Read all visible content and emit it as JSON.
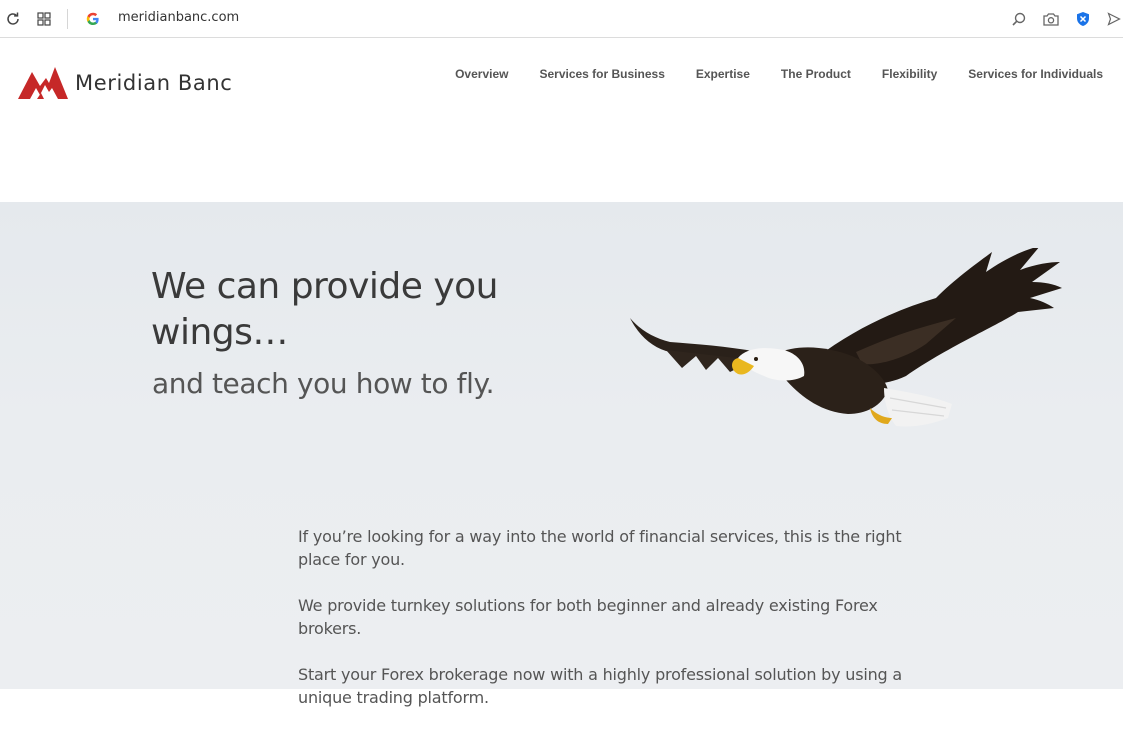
{
  "browser": {
    "url": "meridianbanc.com",
    "icons": [
      "reload-icon",
      "tabs-grid-icon",
      "google-icon",
      "search-icon",
      "camera-icon",
      "shield-icon",
      "send-icon"
    ]
  },
  "site": {
    "brand": "Meridian Banc",
    "brand_color": "#c62828",
    "nav": [
      "Overview",
      "Services for Business",
      "Expertise",
      "The Product",
      "Flexibility",
      "Services for Individuals"
    ]
  },
  "hero": {
    "headline": "We can provide you wings…",
    "subheadline": "and teach you how to fly.",
    "paragraphs": [
      "If you’re looking for a way into the world of financial services, this is the right place for you.",
      "We provide turnkey solutions for both beginner and already existing Forex brokers.",
      "Start your Forex brokerage now with a highly professional solution by using a unique trading platform."
    ]
  }
}
